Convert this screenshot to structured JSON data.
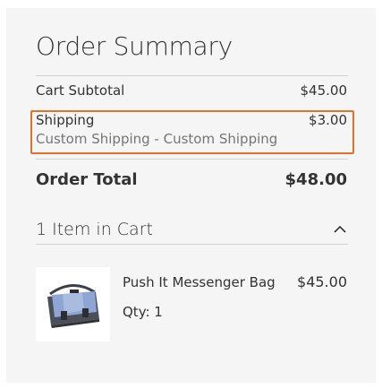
{
  "summary": {
    "title": "Order Summary",
    "subtotal": {
      "label": "Cart Subtotal",
      "amount": "$45.00"
    },
    "shipping": {
      "label": "Shipping",
      "amount": "$3.00",
      "method": "Custom Shipping - Custom Shipping"
    },
    "total": {
      "label": "Order Total",
      "amount": "$48.00"
    },
    "items_toggle": {
      "label": "1 Item in Cart",
      "icon": "chevron-up-icon"
    },
    "items": [
      {
        "name": "Push It Messenger Bag",
        "price": "$45.00",
        "qty": "Qty: 1",
        "image": "messenger-bag-thumbnail"
      }
    ]
  },
  "colors": {
    "panel_background": "#f5f5f5",
    "highlight_border": "#e0742b",
    "divider": "#d1d1d1",
    "text_primary": "#333333",
    "text_secondary": "#757575"
  }
}
